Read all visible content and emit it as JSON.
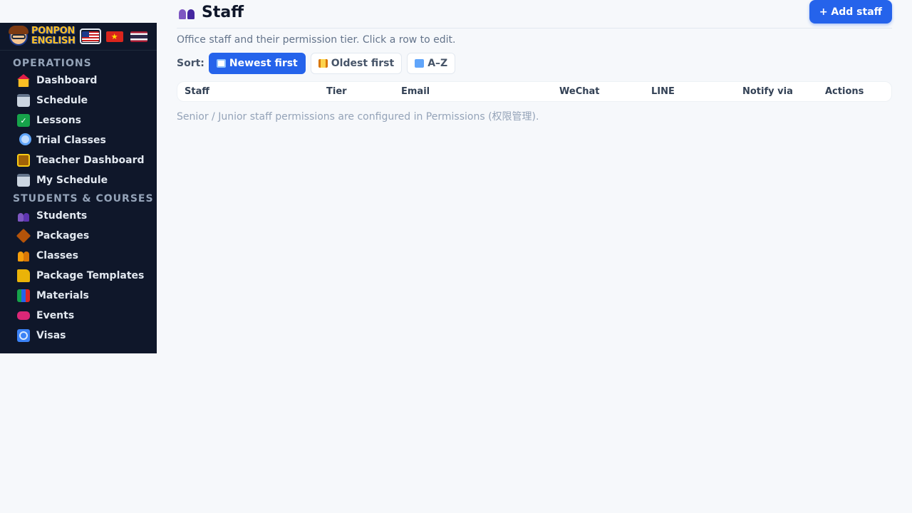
{
  "sidebar": {
    "logo_line1": "PONPON",
    "logo_line2": "ENGLISH",
    "sections": [
      {
        "label": "OPERATIONS"
      },
      {
        "label": "STUDENTS & COURSES"
      }
    ],
    "items": [
      {
        "label": "Dashboard",
        "icon": "house-icon"
      },
      {
        "label": "Schedule",
        "icon": "calendar-icon"
      },
      {
        "label": "Lessons",
        "icon": "check-icon"
      },
      {
        "label": "Trial Classes",
        "icon": "magnifier-icon"
      },
      {
        "label": "Teacher Dashboard",
        "icon": "teacher-icon"
      },
      {
        "label": "My Schedule",
        "icon": "calendar-icon"
      },
      {
        "label": "Students",
        "icon": "people-icon"
      },
      {
        "label": "Packages",
        "icon": "package-icon"
      },
      {
        "label": "Classes",
        "icon": "children-icon"
      },
      {
        "label": "Package Templates",
        "icon": "folder-icon"
      },
      {
        "label": "Materials",
        "icon": "books-icon"
      },
      {
        "label": "Events",
        "icon": "ticket-icon"
      },
      {
        "label": "Visas",
        "icon": "passport-icon"
      }
    ],
    "flags": [
      {
        "lang": "en",
        "icon": "us-flag-icon",
        "active": true
      },
      {
        "lang": "zh",
        "icon": "vietnam-flag-icon",
        "active": false
      },
      {
        "lang": "th",
        "icon": "thailand-flag-icon",
        "active": false
      }
    ]
  },
  "page": {
    "title": "Staff",
    "title_icon": "people-icon",
    "add_button": "+ Add staff",
    "subtitle": "Office staff and their permission tier. Click a row to edit.",
    "sort_label": "Sort:",
    "sort_options": [
      {
        "label": "Newest first",
        "icon": "new-icon",
        "active": true
      },
      {
        "label": "Oldest first",
        "icon": "scroll-icon",
        "active": false
      },
      {
        "label": "A–Z",
        "icon": "abc-icon",
        "active": false
      }
    ],
    "table": {
      "columns": [
        "Staff",
        "Tier",
        "Email",
        "WeChat",
        "LINE",
        "Notify via",
        "Actions"
      ],
      "rows": []
    },
    "footnote": "Senior / Junior staff permissions are configured in Permissions (权限管理)."
  },
  "colors": {
    "sidebar_bg": "#0f172a",
    "accent": "#2563eb",
    "page_bg": "#f6f8fb"
  }
}
